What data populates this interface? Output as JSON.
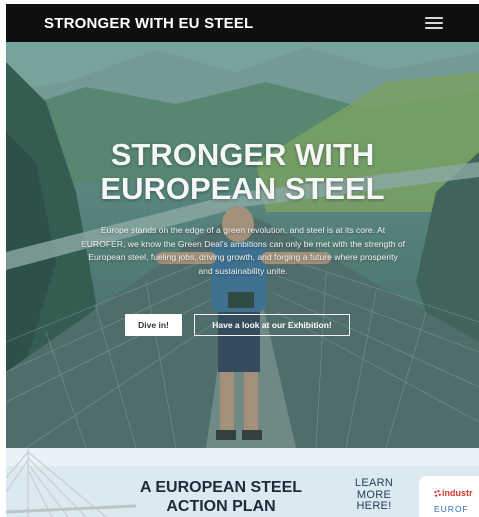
{
  "navbar": {
    "brand": "STRONGER WITH EU STEEL",
    "menu_icon": "hamburger-menu-icon"
  },
  "hero": {
    "title_line1": "STRONGER WITH",
    "title_line2": "EUROPEAN STEEL",
    "body": "Europe stands on the edge of a green revolution, and steel is at its core. At EUROFER, we know the Green Deal's ambitions can only be met with the strength of European steel, fueling jobs, driving growth, and forging a future where prosperity and sustainability unite.",
    "primary_button": "Dive in!",
    "secondary_button": "Have a look at our Exhibition!"
  },
  "banner": {
    "title_line1": "A EUROPEAN STEEL",
    "title_line2": "ACTION PLAN",
    "learn_line1": "LEARN",
    "learn_line2": "MORE",
    "learn_line3": "HERE!",
    "logo_text": "industr",
    "logo_sub": "EUROF"
  },
  "colors": {
    "navbar_bg": "#0e0f10",
    "hero_tint": "#5f8a82",
    "banner_bg": "#dbe9f1",
    "banner_title": "#1d2b3a",
    "logo_red": "#d1392b",
    "logo_blue": "#2f6db5"
  }
}
